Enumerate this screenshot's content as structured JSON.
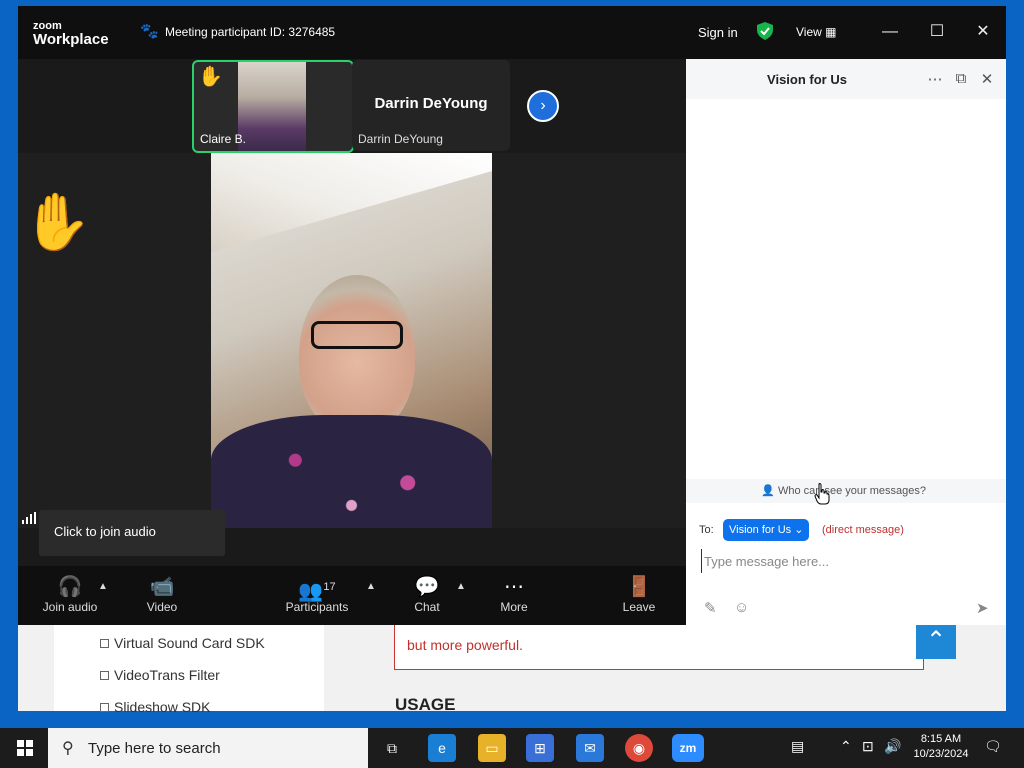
{
  "background_page": {
    "left_items": [
      "Virtual Sound Card SDK",
      "VideoTrans Filter",
      "Slideshow SDK"
    ],
    "card_text": "but more powerful.",
    "usage_heading": "USAGE"
  },
  "zoom": {
    "logo_top": "zoom",
    "logo_bottom": "Workplace",
    "participant_id": "Meeting participant ID: 3276485",
    "sign_in": "Sign in",
    "view": "View",
    "thumbnails": [
      {
        "name": "Claire B.",
        "hand_raised": true
      },
      {
        "name": "Darrin DeYoung",
        "big_name": "Darrin DeYoung"
      }
    ],
    "tooltip": "Click to join audio",
    "toolbar": {
      "join_audio": "Join audio",
      "video": "Video",
      "participants": "Participants",
      "participant_count": "17",
      "chat": "Chat",
      "more": "More",
      "leave": "Leave"
    }
  },
  "chat": {
    "title": "Vision for Us",
    "who_can_see": "Who can see your messages?",
    "to_label": "To:",
    "recipient": "Vision for Us",
    "direct_message": "(direct message)",
    "placeholder": "Type message here..."
  },
  "taskbar": {
    "search_placeholder": "Type here to search",
    "time": "8:15 AM",
    "date": "10/23/2024"
  },
  "colors": {
    "accent": "#0e72ed",
    "active_speaker": "#2bd06a",
    "leave": "#e02828"
  }
}
